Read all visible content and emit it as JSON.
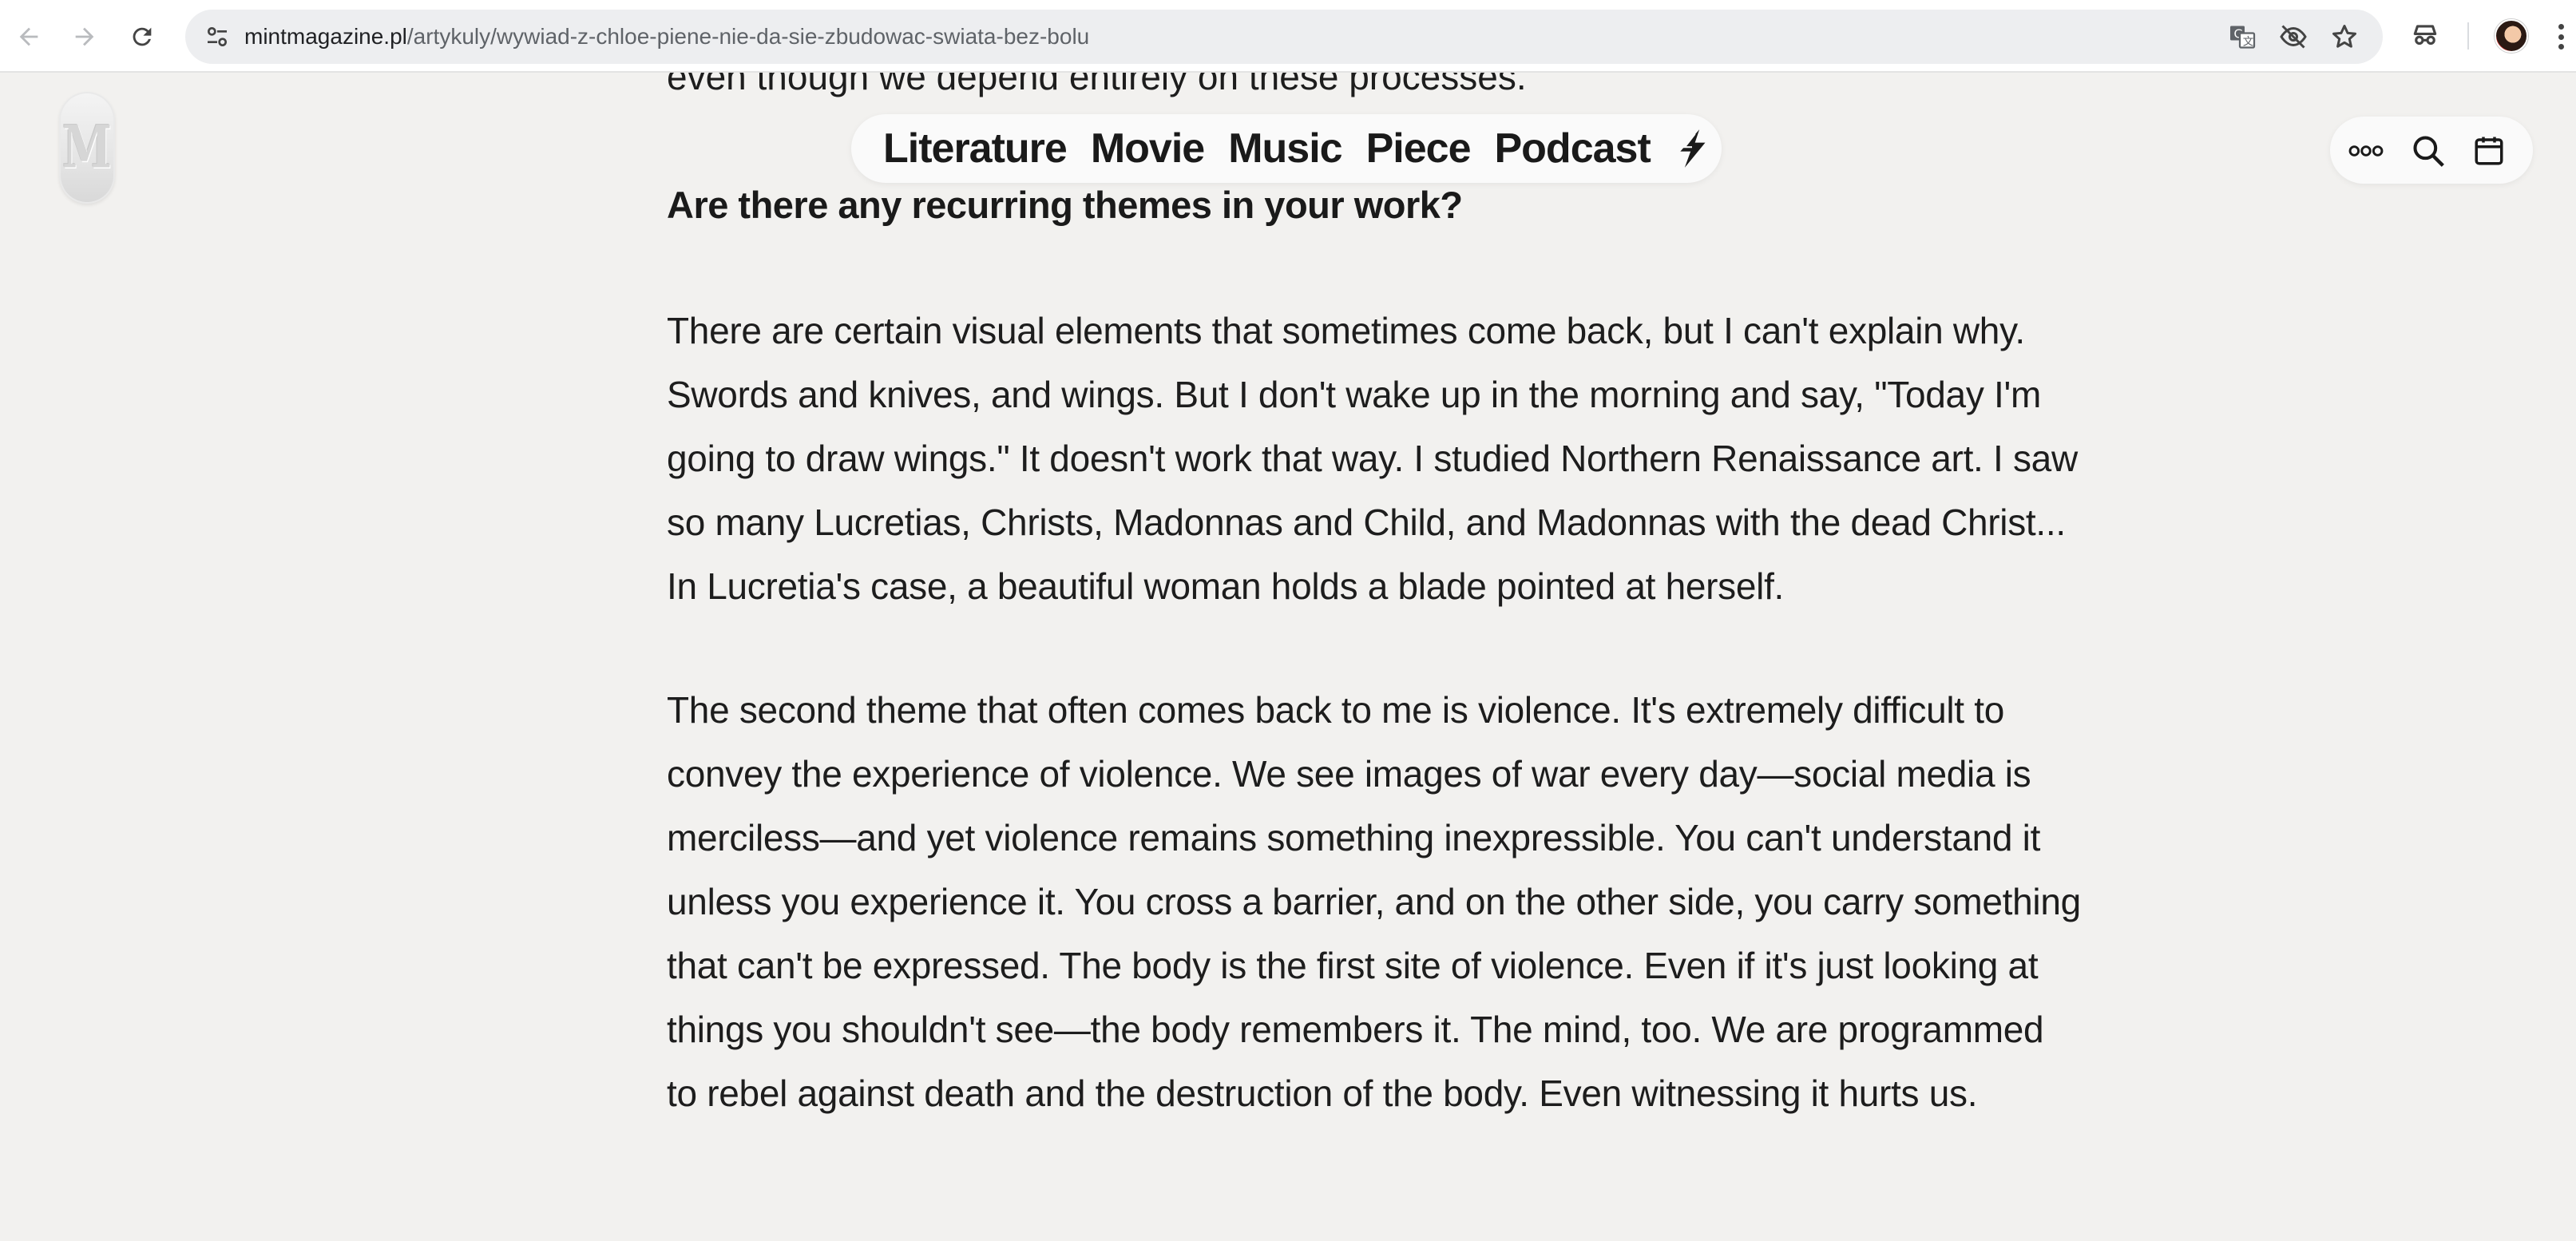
{
  "browser": {
    "url_host": "mintmagazine.pl",
    "url_path": "/artykuly/wywiad-z-chloe-piene-nie-da-sie-zbudowac-swiata-bez-bolu",
    "icons": [
      "back-icon",
      "forward-icon",
      "reload-icon",
      "site-settings-icon",
      "translate-icon",
      "eye-off-icon",
      "star-icon",
      "incognito-icon",
      "profile-avatar",
      "kebab-menu-icon"
    ]
  },
  "site": {
    "logo_letter": "M",
    "nav": [
      "Literature",
      "Movie",
      "Music",
      "Piece",
      "Podcast"
    ],
    "tools": [
      "more-icon",
      "search-icon",
      "calendar-icon"
    ]
  },
  "article": {
    "clipped_line": "even though we depend entirely on these processes.",
    "question": "Are there any recurring themes in your work?",
    "para1": [
      "There are certain visual elements that sometimes come back, but I can't explain why.",
      "Swords and knives, and wings. But I don't wake up in the morning and say, \"Today I'm",
      "going to draw wings.\" It doesn't work that way. I studied Northern Renaissance art. I saw",
      "so many Lucretias, Christs, Madonnas and Child, and Madonnas with the dead Christ...",
      "In Lucretia's case, a beautiful woman holds a blade pointed at herself."
    ],
    "para2": [
      "The second theme that often comes back to me is violence. It's extremely difficult to",
      "convey the experience of violence. We see images of war every day—social media is",
      "merciless—and yet violence remains something inexpressible. You can't understand it",
      "unless you experience it. You cross a barrier, and on the other side, you carry something",
      "that can't be expressed. The body is the first site of violence. Even if it's just looking at",
      "things you shouldn't see—the body remembers it. The mind, too. We are programmed",
      "to rebel against death and the destruction of the body. Even witnessing it hurts us."
    ]
  }
}
